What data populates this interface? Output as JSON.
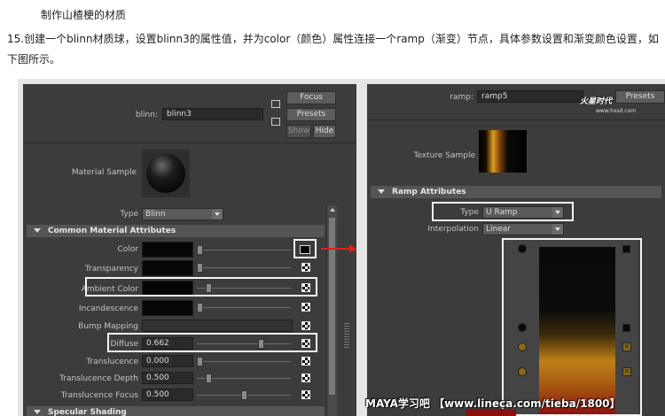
{
  "doc": {
    "title": "制作山楂梗的材质",
    "step": "15.创建一个blinn材质球，设置blinn3的属性值，并为color（颜色）属性连接一个ramp（渐变）节点，具体参数设置和渐变颜色设置，如下图所示。"
  },
  "left": {
    "node_label": "blinn:",
    "node_value": "blinn3",
    "focus": "Focus",
    "presets": "Presets",
    "show": "Show",
    "hide": "Hide",
    "sample_label": "Material Sample",
    "type_label": "Type",
    "type_value": "Blinn",
    "section_common": "Common Material Attributes",
    "section_specular": "Specular Shading",
    "attrs": {
      "color": "Color",
      "transparency": "Transparency",
      "ambient": "Ambient Color",
      "incandescence": "Incandescence",
      "bump": "Bump Mapping",
      "diffuse": "Diffuse",
      "diffuse_value": "0.662",
      "translucence": "Translucence",
      "translucence_value": "0.000",
      "depth": "Translucence Depth",
      "depth_value": "0.500",
      "focus": "Translucence Focus",
      "focus_value": "0.500"
    }
  },
  "right": {
    "node_label": "ramp:",
    "node_value": "ramp5",
    "presets": "Presets",
    "sample_label": "Texture Sample",
    "section": "Ramp Attributes",
    "type_label": "Type",
    "type_value": "U Ramp",
    "interp_label": "Interpolation",
    "interp_value": "Linear"
  },
  "watermark": "MAYA学习吧 【www.lineca.com/tieba/1800】",
  "logo": "火星时代",
  "logo_sub": "www.hxsd.com",
  "colors": {
    "panel": "#3c3c3c",
    "arrow": "#e02020",
    "ramp_top": "#0a0a0a",
    "ramp_mid": "#c08018",
    "ramp_bottom": "#8a1010"
  }
}
